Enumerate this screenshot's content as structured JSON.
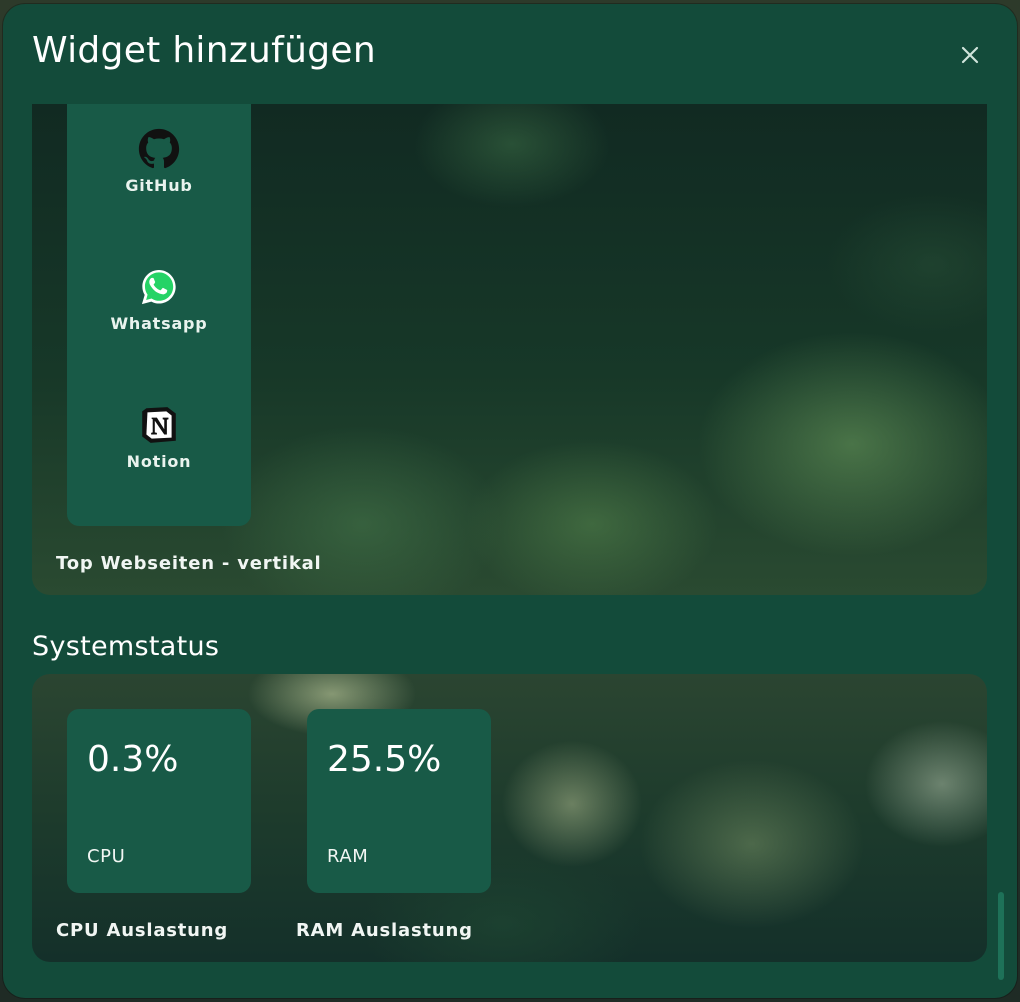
{
  "dialog": {
    "title": "Widget hinzufügen",
    "close_icon": "close-icon"
  },
  "top_websites_vertical": {
    "caption": "Top Webseiten - vertikal",
    "items": [
      {
        "label": "GitHub",
        "icon": "github-icon"
      },
      {
        "label": "Whatsapp",
        "icon": "whatsapp-icon"
      },
      {
        "label": "Notion",
        "icon": "notion-icon"
      }
    ]
  },
  "systemstatus": {
    "heading": "Systemstatus",
    "cpu": {
      "value": "0.3%",
      "label": "CPU",
      "caption": "CPU Auslastung"
    },
    "ram": {
      "value": "25.5%",
      "label": "RAM",
      "caption": "RAM Auslastung"
    }
  },
  "colors": {
    "dialog_background": "#134b3a",
    "tile_background": "#185a47",
    "scrollbar_thumb": "#1e7158",
    "text": "#ffffff"
  }
}
